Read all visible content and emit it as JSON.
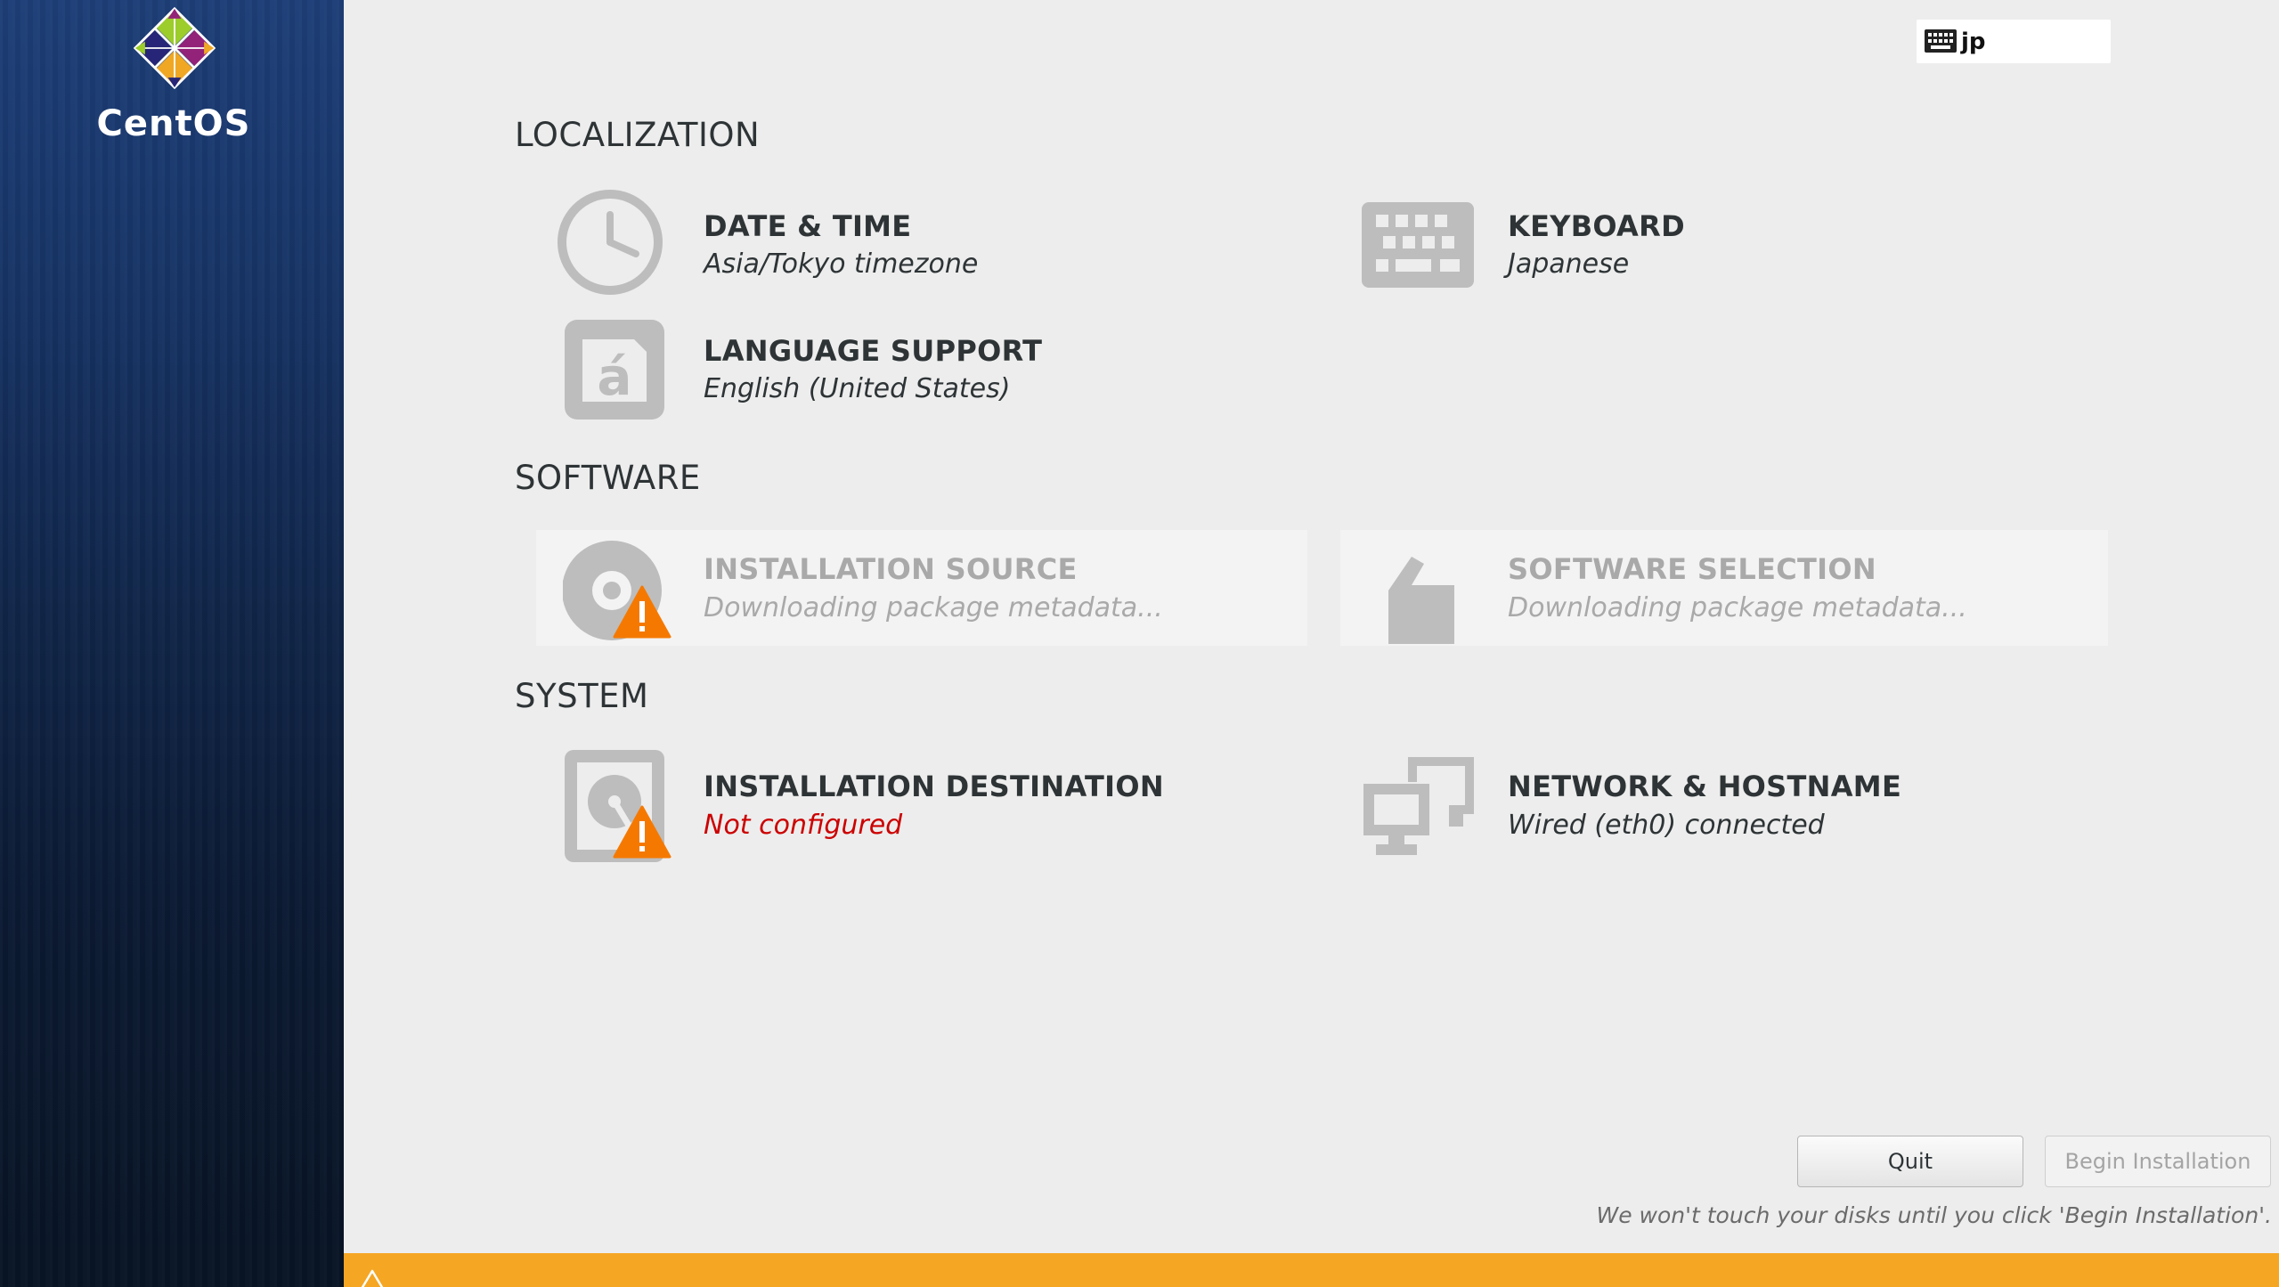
{
  "brand": {
    "name": "CentOS"
  },
  "keyboard_indicator": {
    "layout": "jp"
  },
  "sections": {
    "localization": {
      "title": "LOCALIZATION"
    },
    "software": {
      "title": "SOFTWARE"
    },
    "system": {
      "title": "SYSTEM"
    }
  },
  "spokes": {
    "date_time": {
      "title": "DATE & TIME",
      "status": "Asia/Tokyo timezone"
    },
    "keyboard": {
      "title": "KEYBOARD",
      "status": "Japanese"
    },
    "language_support": {
      "title": "LANGUAGE SUPPORT",
      "status": "English (United States)"
    },
    "installation_source": {
      "title": "INSTALLATION SOURCE",
      "status": "Downloading package metadata..."
    },
    "software_selection": {
      "title": "SOFTWARE SELECTION",
      "status": "Downloading package metadata..."
    },
    "installation_destination": {
      "title": "INSTALLATION DESTINATION",
      "status": "Not configured"
    },
    "network_hostname": {
      "title": "NETWORK & HOSTNAME",
      "status": "Wired (eth0) connected"
    }
  },
  "buttons": {
    "quit": "Quit",
    "begin_installation": "Begin Installation"
  },
  "footnote": "We won't touch your disks until you click 'Begin Installation'.",
  "colors": {
    "warning": "#f57900",
    "warning_bar": "#f5a623",
    "error_text": "#cc0000",
    "sidebar_top": "#1d3e78",
    "sidebar_bottom": "#081424"
  },
  "icons": {
    "date_time": "clock-icon",
    "keyboard": "keyboard-icon",
    "language_support": "language-icon",
    "installation_source": "disc-icon",
    "software_selection": "package-icon",
    "installation_destination": "harddisk-icon",
    "network_hostname": "network-icon",
    "warning": "warning-icon"
  }
}
